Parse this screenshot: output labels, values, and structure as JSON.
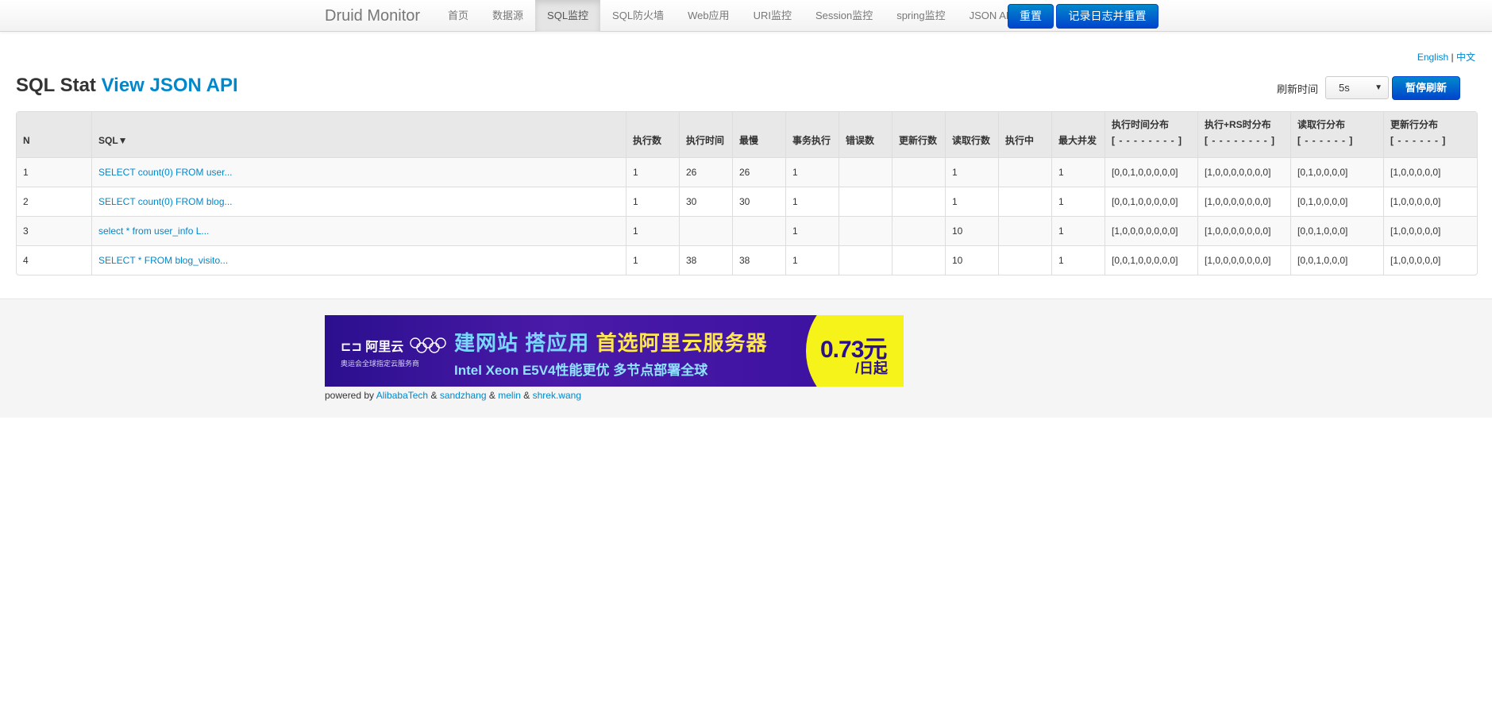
{
  "navbar": {
    "brand": "Druid Monitor",
    "items": [
      "首页",
      "数据源",
      "SQL监控",
      "SQL防火墙",
      "Web应用",
      "URI监控",
      "Session监控",
      "spring监控",
      "JSON API"
    ],
    "active_index": 2,
    "reset_label": "重置",
    "log_reset_label": "记录日志并重置"
  },
  "lang": {
    "english": "English",
    "sep": "|",
    "chinese": "中文"
  },
  "title": {
    "prefix": "SQL Stat",
    "link": "View JSON API"
  },
  "refresh": {
    "label": "刷新时间",
    "value": "5s",
    "pause_label": "暂停刷新"
  },
  "table": {
    "headers": [
      "N",
      "SQL▼",
      "执行数",
      "执行时间",
      "最慢",
      "事务执行",
      "错误数",
      "更新行数",
      "读取行数",
      "执行中",
      "最大并发",
      "执行时间分布",
      "执行+RS时分布",
      "读取行分布",
      "更新行分布"
    ],
    "subheaders": {
      "exec_time_dist": "[ - - - - - - - - ]",
      "exec_rs_dist": "[ - - - - - - - - ]",
      "read_dist": "[ - - - - - - ]",
      "update_dist": "[ - - - - - - ]"
    },
    "rows": [
      [
        "1",
        "SELECT count(0) FROM user...",
        "1",
        "26",
        "26",
        "1",
        "",
        "",
        "1",
        "",
        "1",
        "[0,0,1,0,0,0,0,0]",
        "[1,0,0,0,0,0,0,0]",
        "[0,1,0,0,0,0]",
        "[1,0,0,0,0,0]"
      ],
      [
        "2",
        "SELECT count(0) FROM blog...",
        "1",
        "30",
        "30",
        "1",
        "",
        "",
        "1",
        "",
        "1",
        "[0,0,1,0,0,0,0,0]",
        "[1,0,0,0,0,0,0,0]",
        "[0,1,0,0,0,0]",
        "[1,0,0,0,0,0]"
      ],
      [
        "3",
        "select * from user_info L...",
        "1",
        "",
        "",
        "1",
        "",
        "",
        "10",
        "",
        "1",
        "[1,0,0,0,0,0,0,0]",
        "[1,0,0,0,0,0,0,0]",
        "[0,0,1,0,0,0]",
        "[1,0,0,0,0,0]"
      ],
      [
        "4",
        "SELECT * FROM blog_visito...",
        "1",
        "38",
        "38",
        "1",
        "",
        "",
        "10",
        "",
        "1",
        "[0,0,1,0,0,0,0,0]",
        "[1,0,0,0,0,0,0,0]",
        "[0,0,1,0,0,0]",
        "[1,0,0,0,0,0]"
      ]
    ]
  },
  "banner": {
    "logo": "阿里云",
    "logo_sub": "奥运会全球指定云服务商",
    "headline_a": "建网站 搭应用",
    "headline_b": "首选阿里云服务器",
    "sub": "Intel Xeon E5V4性能更优 多节点部署全球",
    "price": "0.73元",
    "unit": "/日起"
  },
  "footer": {
    "powered_by": "powered by",
    "amp": "&",
    "links": [
      "AlibabaTech",
      "sandzhang",
      "melin",
      "shrek.wang"
    ]
  }
}
